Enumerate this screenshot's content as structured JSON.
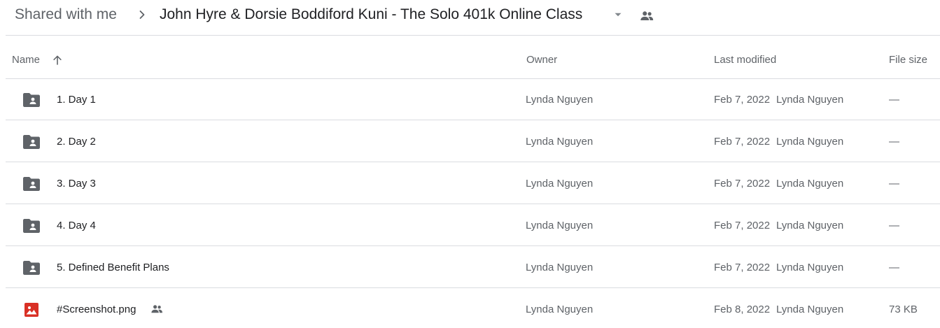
{
  "breadcrumb": {
    "root": "Shared with me",
    "current": "John Hyre & Dorsie Boddiford Kuni - The Solo 401k Online Class"
  },
  "columns": {
    "name": "Name",
    "owner": "Owner",
    "last_modified": "Last modified",
    "file_size": "File size"
  },
  "sort": {
    "column": "Name",
    "direction": "ascending",
    "icon": "arrow-up-icon"
  },
  "colors": {
    "folder_icon": "#5f6368",
    "image_icon": "#d93025",
    "divider": "#dadce0",
    "text_primary": "#202124",
    "text_secondary": "#5f6368"
  },
  "rows": [
    {
      "type": "shared-folder",
      "icon": "shared-folder-icon",
      "name": "1. Day 1",
      "owner": "Lynda Nguyen",
      "modified_date": "Feb 7, 2022",
      "modified_by": "Lynda Nguyen",
      "size": "—"
    },
    {
      "type": "shared-folder",
      "icon": "shared-folder-icon",
      "name": "2. Day 2",
      "owner": "Lynda Nguyen",
      "modified_date": "Feb 7, 2022",
      "modified_by": "Lynda Nguyen",
      "size": "—"
    },
    {
      "type": "shared-folder",
      "icon": "shared-folder-icon",
      "name": "3. Day 3",
      "owner": "Lynda Nguyen",
      "modified_date": "Feb 7, 2022",
      "modified_by": "Lynda Nguyen",
      "size": "—"
    },
    {
      "type": "shared-folder",
      "icon": "shared-folder-icon",
      "name": "4. Day 4",
      "owner": "Lynda Nguyen",
      "modified_date": "Feb 7, 2022",
      "modified_by": "Lynda Nguyen",
      "size": "—"
    },
    {
      "type": "shared-folder",
      "icon": "shared-folder-icon",
      "name": "5. Defined Benefit Plans",
      "owner": "Lynda Nguyen",
      "modified_date": "Feb 7, 2022",
      "modified_by": "Lynda Nguyen",
      "size": "—"
    },
    {
      "type": "image",
      "icon": "image-file-icon",
      "name": "#Screenshot.png",
      "shared": true,
      "owner": "Lynda Nguyen",
      "modified_date": "Feb 8, 2022",
      "modified_by": "Lynda Nguyen",
      "size": "73 KB"
    }
  ]
}
